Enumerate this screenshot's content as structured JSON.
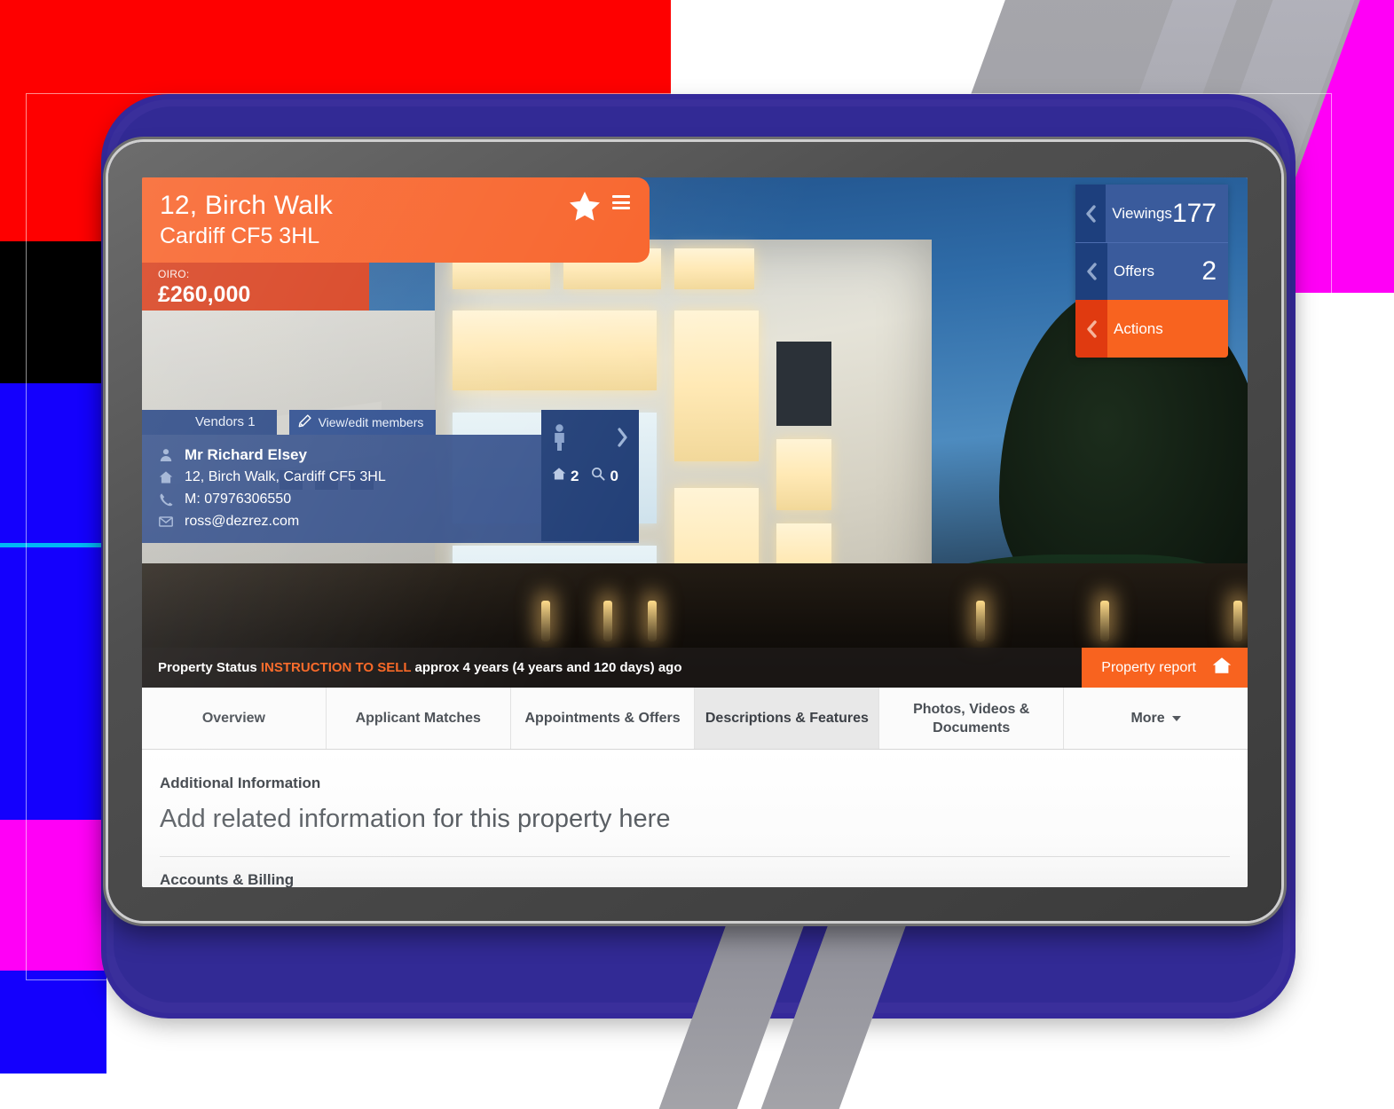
{
  "property": {
    "title": "12, Birch Walk",
    "subtitle": "Cardiff CF5 3HL",
    "price_label": "OIRO:",
    "price_value": "£260,000",
    "favourite_icon": "star-icon",
    "menu_icon": "hamburger-menu-icon"
  },
  "stats": [
    {
      "label": "Viewings",
      "value": "177",
      "style": "blue",
      "chevron": "chevron-left-icon"
    },
    {
      "label": "Offers",
      "value": "2",
      "style": "blue",
      "chevron": "chevron-left-icon"
    },
    {
      "label": "Actions",
      "value": "",
      "style": "orange",
      "chevron": "chevron-left-icon"
    }
  ],
  "vendors": {
    "tab_label": "Vendors 1",
    "edit_label": "View/edit members",
    "edit_icon": "pencil-icon",
    "name": "Mr Richard Elsey",
    "address": "12, Birch Walk, Cardiff CF5 3HL",
    "phone": "M: 07976306550",
    "email": "ross@dezrez.com",
    "icons": {
      "name": "person-icon",
      "address": "home-icon",
      "phone": "phone-icon",
      "email": "envelope-icon"
    },
    "mini": {
      "person_icon": "person-icon",
      "next_icon": "chevron-right-icon",
      "properties_icon": "home-icon",
      "properties_count": "2",
      "searches_icon": "search-icon",
      "searches_count": "0"
    }
  },
  "status": {
    "prefix": "Property Status",
    "highlight": "INSTRUCTION TO SELL",
    "suffix": "approx 4 years (4 years and 120 days) ago",
    "report_button": "Property report",
    "report_icon": "home-icon"
  },
  "tabs": [
    {
      "label": "Overview",
      "active": false
    },
    {
      "label": "Applicant Matches",
      "active": false
    },
    {
      "label": "Appointments & Offers",
      "active": false
    },
    {
      "label": "Descriptions & Features",
      "active": true
    },
    {
      "label": "Photos, Videos & Documents",
      "active": false
    },
    {
      "label": "More",
      "active": false,
      "has_caret": true
    }
  ],
  "content": {
    "heading": "Additional Information",
    "placeholder": "Add related information for this property here",
    "next_heading": "Accounts & Billing"
  },
  "colors": {
    "accent_orange": "#f8632a",
    "price_orange": "#d8411f",
    "panel_blue": "#3a5b9c",
    "panel_blue_dark": "#1d3f7d",
    "status_highlight": "#f8631f"
  }
}
